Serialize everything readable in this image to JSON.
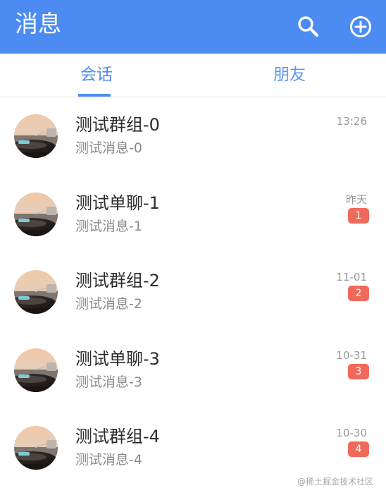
{
  "header": {
    "title": "消息",
    "search_icon": "search-icon",
    "add_icon": "add-circle-icon",
    "background_color": "#4c8cf2"
  },
  "tabs": [
    {
      "label": "会话",
      "active": true
    },
    {
      "label": "朋友",
      "active": false
    }
  ],
  "conversations": [
    {
      "name": "测试群组-0",
      "message": "测试消息-0",
      "time": "13:26",
      "unread": ""
    },
    {
      "name": "测试单聊-1",
      "message": "测试消息-1",
      "time": "昨天",
      "unread": "1"
    },
    {
      "name": "测试群组-2",
      "message": "测试消息-2",
      "time": "11-01",
      "unread": "2"
    },
    {
      "name": "测试单聊-3",
      "message": "测试消息-3",
      "time": "10-31",
      "unread": "3"
    },
    {
      "name": "测试群组-4",
      "message": "测试消息-4",
      "time": "10-30",
      "unread": "4"
    }
  ],
  "badge_color": "#f06a5c",
  "watermark": "@稀土掘金技术社区"
}
